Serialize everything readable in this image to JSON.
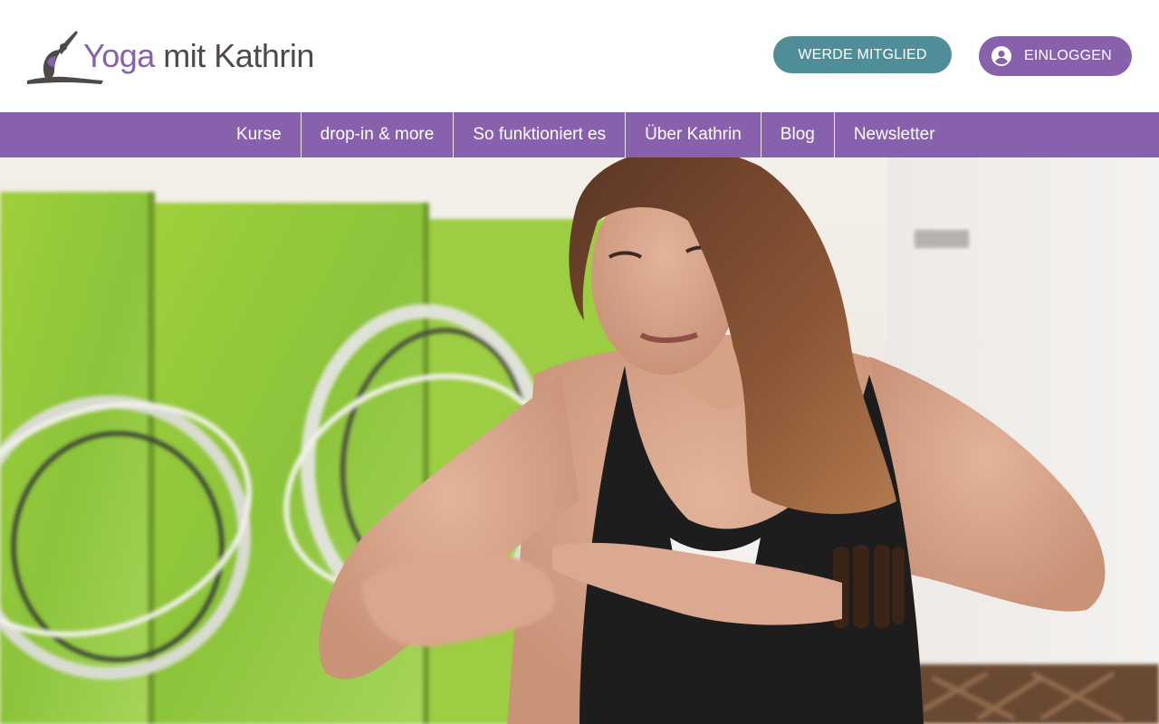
{
  "header": {
    "logo": {
      "brand_first": "Yoga",
      "brand_rest": "mit Kathrin"
    },
    "member_button": {
      "label": "WERDE MITGLIED"
    },
    "login_button": {
      "label": "EINLOGGEN",
      "icon": "user-circle-icon"
    }
  },
  "nav": {
    "items": [
      {
        "label": "Kurse"
      },
      {
        "label": "drop-in & more"
      },
      {
        "label": "So funktioniert es"
      },
      {
        "label": "Über Kathrin"
      },
      {
        "label": "Blog"
      },
      {
        "label": "Newsletter"
      }
    ]
  },
  "hero": {
    "image": "yoga-teacher-photo"
  },
  "colors": {
    "primary_purple": "#8761ab",
    "teal": "#4f8e99",
    "logo_gray": "#4f4a47"
  }
}
